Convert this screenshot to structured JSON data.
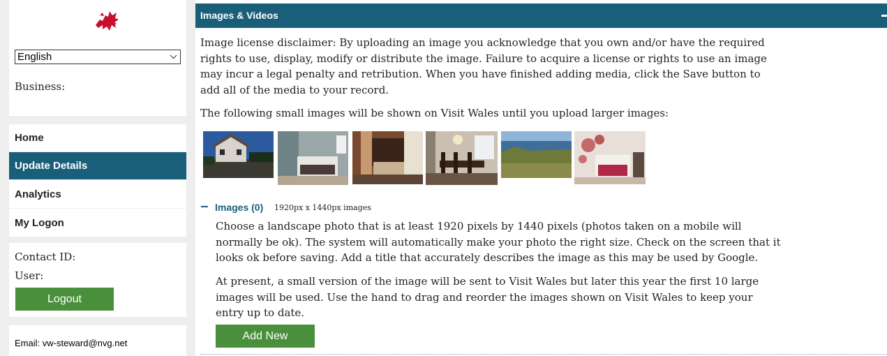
{
  "sidebar": {
    "language": "English",
    "business_label": "Business:",
    "nav": [
      {
        "label": "Home",
        "active": false
      },
      {
        "label": "Update Details",
        "active": true
      },
      {
        "label": "Analytics",
        "active": false
      },
      {
        "label": "My Logon",
        "active": false
      }
    ],
    "contact_id_label": "Contact ID:",
    "user_label": "User:",
    "logout_label": "Logout",
    "email": "Email: vw-steward@nvg.net"
  },
  "main": {
    "section_title": "Images & Videos",
    "disclaimer": "Image license disclaimer: By uploading an image you acknowledge that you own and/or have the required rights to use, display, modify or distribute the image. Failure to acquire a license or rights to use an image may incur a legal penalty and retribution. When you have finished adding media, click the Save button to add all of the media to your record.",
    "small_images_note": "The following small images will be shown on Visit Wales until you upload larger images:",
    "images_title": "Images (0)",
    "images_subtitle": "1920px x 1440px images",
    "images_instructions": "Choose a landscape photo that is at least 1920 pixels by 1440 pixels (photos taken on a mobile will normally be ok). The system will automatically make your photo the right size. Check on the screen that it looks ok before saving. Add a title that accurately describes the image as this may be used by Google.",
    "images_note": "At present, a small version of the image will be sent to Visit Wales but later this year the first 10 large images will be used. Use the hand to drag and reorder the images shown on Visit Wales to keep your entry up to date.",
    "add_new_label": "Add New"
  },
  "colors": {
    "brand": "#1a5f7a",
    "button_green": "#4a8f3c",
    "dragon_red": "#c8102e"
  }
}
